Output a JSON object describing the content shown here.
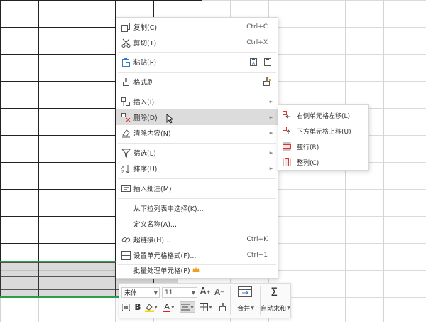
{
  "context_menu": {
    "items": [
      {
        "icon": "copy-icon",
        "label": "复制(C)",
        "shortcut": "Ctrl+C"
      },
      {
        "icon": "cut-icon",
        "label": "剪切(T)",
        "shortcut": "Ctrl+X"
      },
      {
        "icon": "paste-icon",
        "label": "粘贴(P)"
      },
      {
        "icon": "format-painter-icon",
        "label": "格式刷"
      },
      {
        "icon": "insert-icon",
        "label": "插入(I)"
      },
      {
        "icon": "delete-icon",
        "label": "删除(D)"
      },
      {
        "icon": "clear-icon",
        "label": "清除内容(N)"
      },
      {
        "icon": "filter-icon",
        "label": "筛选(L)"
      },
      {
        "icon": "sort-icon",
        "label": "排序(U)"
      },
      {
        "icon": "comment-icon",
        "label": "插入批注(M)"
      },
      {
        "label": "从下拉列表中选择(K)..."
      },
      {
        "label": "定义名称(A)..."
      },
      {
        "icon": "hyperlink-icon",
        "label": "超链接(H)...",
        "shortcut": "Ctrl+K"
      },
      {
        "icon": "cell-format-icon",
        "label": "设置单元格格式(F)...",
        "shortcut": "Ctrl+1"
      },
      {
        "label": "批量处理单元格(P)",
        "badge_icon": "crown-icon"
      }
    ],
    "highlighted": "删除(D)"
  },
  "delete_submenu": {
    "items": [
      {
        "icon": "shift-left-icon",
        "label": "右侧单元格左移(L)"
      },
      {
        "icon": "shift-up-icon",
        "label": "下方单元格上移(U)"
      },
      {
        "icon": "delete-row-icon",
        "label": "整行(R)"
      },
      {
        "icon": "delete-column-icon",
        "label": "整列(C)"
      }
    ]
  },
  "mini_toolbar": {
    "font_name": "宋体",
    "font_size": "11",
    "increase_font": "A",
    "decrease_font": "A",
    "bold": "B",
    "font_color_letter": "A",
    "merge_label": "合并",
    "autosum_label": "自动求和",
    "autosum_symbol": "Σ",
    "colors": {
      "highlight": "#f5d90a",
      "font_color": "#e02020"
    }
  },
  "colors": {
    "selection_border": "#2e9d48",
    "menu_highlight": "#dcdcdc"
  }
}
